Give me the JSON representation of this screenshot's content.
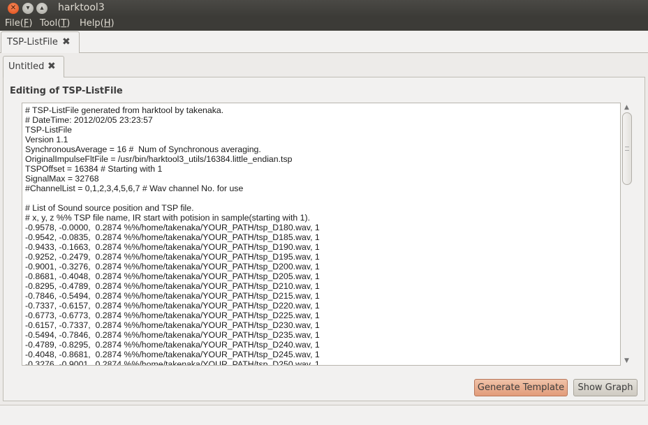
{
  "window": {
    "title": "harktool3"
  },
  "menu": [
    {
      "label": "File",
      "mnemonic": "F"
    },
    {
      "label": "Tool",
      "mnemonic": "T"
    },
    {
      "label": "Help",
      "mnemonic": "H"
    }
  ],
  "tabs": {
    "outer": "TSP-ListFile",
    "inner": "Untitled"
  },
  "editor": {
    "section_title": "Editing of TSP-ListFile",
    "content": "# TSP-ListFile generated from harktool by takenaka.\n# DateTime: 2012/02/05 23:23:57\nTSP-ListFile\nVersion 1.1\nSynchronousAverage = 16 #  Num of Synchronous averaging.\nOriginalImpulseFltFile = /usr/bin/harktool3_utils/16384.little_endian.tsp\nTSPOffset = 16384 # Starting with 1\nSignalMax = 32768\n#ChannelList = 0,1,2,3,4,5,6,7 # Wav channel No. for use\n\n# List of Sound source position and TSP file.\n# x, y, z %% TSP file name, IR start with potision in sample(starting with 1).\n-0.9578, -0.0000,  0.2874 %%/home/takenaka/YOUR_PATH/tsp_D180.wav, 1\n-0.9542, -0.0835,  0.2874 %%/home/takenaka/YOUR_PATH/tsp_D185.wav, 1\n-0.9433, -0.1663,  0.2874 %%/home/takenaka/YOUR_PATH/tsp_D190.wav, 1\n-0.9252, -0.2479,  0.2874 %%/home/takenaka/YOUR_PATH/tsp_D195.wav, 1\n-0.9001, -0.3276,  0.2874 %%/home/takenaka/YOUR_PATH/tsp_D200.wav, 1\n-0.8681, -0.4048,  0.2874 %%/home/takenaka/YOUR_PATH/tsp_D205.wav, 1\n-0.8295, -0.4789,  0.2874 %%/home/takenaka/YOUR_PATH/tsp_D210.wav, 1\n-0.7846, -0.5494,  0.2874 %%/home/takenaka/YOUR_PATH/tsp_D215.wav, 1\n-0.7337, -0.6157,  0.2874 %%/home/takenaka/YOUR_PATH/tsp_D220.wav, 1\n-0.6773, -0.6773,  0.2874 %%/home/takenaka/YOUR_PATH/tsp_D225.wav, 1\n-0.6157, -0.7337,  0.2874 %%/home/takenaka/YOUR_PATH/tsp_D230.wav, 1\n-0.5494, -0.7846,  0.2874 %%/home/takenaka/YOUR_PATH/tsp_D235.wav, 1\n-0.4789, -0.8295,  0.2874 %%/home/takenaka/YOUR_PATH/tsp_D240.wav, 1\n-0.4048, -0.8681,  0.2874 %%/home/takenaka/YOUR_PATH/tsp_D245.wav, 1\n-0.3276, -0.9001,  0.2874 %%/home/takenaka/YOUR_PATH/tsp_D250.wav, 1"
  },
  "buttons": {
    "generate": "Generate Template",
    "graph": "Show Graph"
  },
  "icons": {
    "close": "close-icon",
    "minimize": "minimize-icon",
    "maximize": "maximize-icon",
    "tab_close": "tab-close-icon",
    "scroll_up": "scroll-up-arrow-icon",
    "scroll_down": "scroll-down-arrow-icon"
  }
}
